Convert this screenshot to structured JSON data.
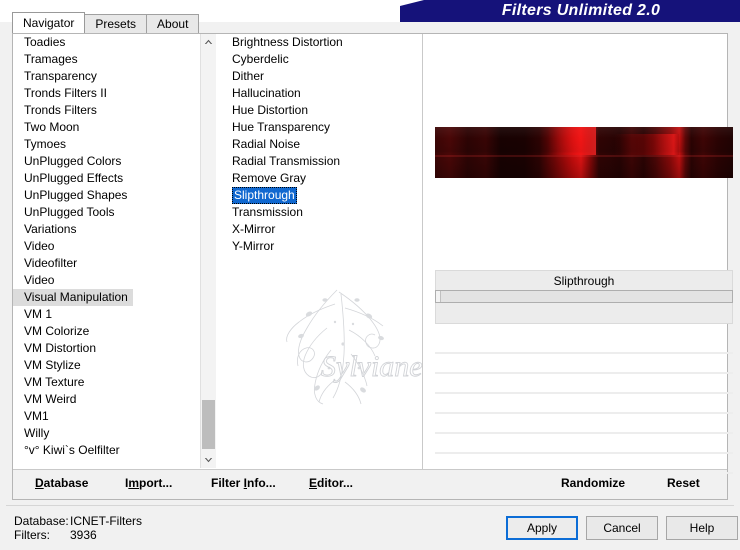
{
  "window": {
    "title": "Filters Unlimited 2.0"
  },
  "tabs": [
    {
      "label": "Navigator",
      "active": true
    },
    {
      "label": "Presets",
      "active": false
    },
    {
      "label": "About",
      "active": false
    }
  ],
  "category_list": {
    "name": "filter-category-list",
    "selected": "Visual Manipulation",
    "items": [
      "Toadies",
      "Tramages",
      "Transparency",
      "Tronds Filters II",
      "Tronds Filters",
      "Two Moon",
      "Tymoes",
      "UnPlugged Colors",
      "UnPlugged Effects",
      "UnPlugged Shapes",
      "UnPlugged Tools",
      "Variations",
      "Video",
      "Videofilter",
      "Video",
      "Visual Manipulation",
      "VM 1",
      "VM Colorize",
      "VM Distortion",
      "VM Stylize",
      "VM Texture",
      "VM Weird",
      "VM1",
      "Willy",
      "°v° Kiwi`s Oelfilter"
    ]
  },
  "filter_list": {
    "name": "filter-effect-list",
    "selected": "Slipthrough",
    "items": [
      "Brightness Distortion",
      "Cyberdelic",
      "Dither",
      "Hallucination",
      "Hue Distortion",
      "Hue Transparency",
      "Radial Noise",
      "Radial Transmission",
      "Remove Gray",
      "Slipthrough",
      "Transmission",
      "X-Mirror",
      "Y-Mirror"
    ]
  },
  "watermark": {
    "signature": "Sylviane"
  },
  "preview": {
    "alt": "filter preview thumbnail"
  },
  "parameters": {
    "title": "Slipthrough",
    "empty_row_count": 7
  },
  "action_bar": {
    "database": {
      "accel": "D",
      "rest": "atabase"
    },
    "import": {
      "pre": "I",
      "accel": "m",
      "rest": "port..."
    },
    "filter_info": {
      "pre": "Filter ",
      "accel": "I",
      "rest": "nfo..."
    },
    "editor": {
      "accel": "E",
      "rest": "ditor..."
    },
    "randomize": "Randomize",
    "reset": "Reset"
  },
  "status": {
    "database_label": "Database:",
    "database_value": "ICNET-Filters",
    "filters_label": "Filters:",
    "filters_value": "3936"
  },
  "dialog_buttons": {
    "apply": "Apply",
    "cancel": "Cancel",
    "help": "Help"
  },
  "colors": {
    "title_banner": "#15127a",
    "selection_blue": "#1068d0",
    "selection_gray": "#dcdcdc",
    "focus_border": "#0c6dd6"
  },
  "scrollbar": {
    "up_arrow": "chevron-up-icon",
    "down_arrow": "chevron-down-icon"
  }
}
